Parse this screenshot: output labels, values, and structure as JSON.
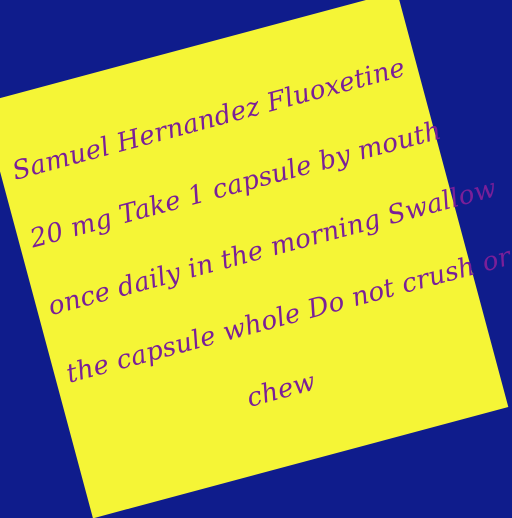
{
  "label": {
    "lines": [
      "Samuel Hernandez Fluoxetine",
      "20 mg Take 1 capsule by mouth",
      "once daily in the morning Swallow",
      "the capsule whole Do not crush or",
      "chew"
    ]
  },
  "colors": {
    "background": "#0f1c8c",
    "paper": "#f5f536",
    "text": "#7a1f98"
  }
}
